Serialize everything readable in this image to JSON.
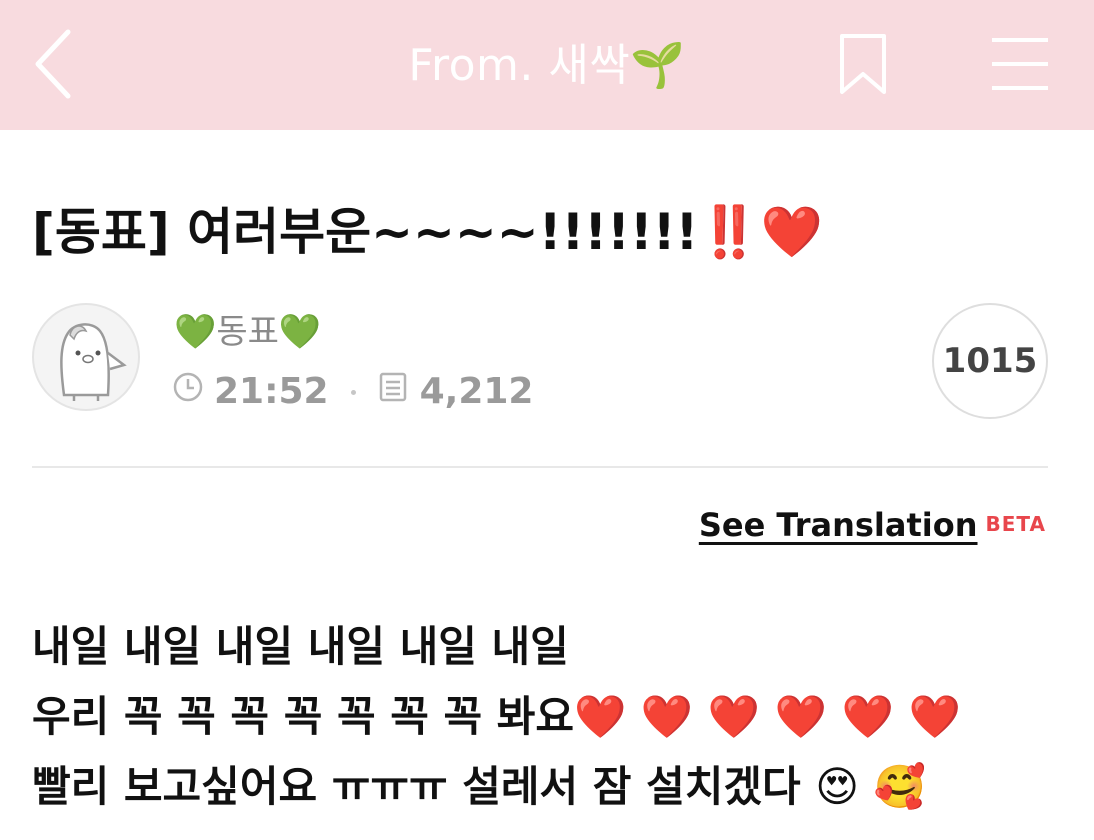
{
  "header": {
    "title": "From. 새싹🌱",
    "background": "#f8dbdf",
    "icons": [
      "back-chevron-icon",
      "bookmark-icon",
      "menu-icon"
    ]
  },
  "post": {
    "title": "[동표] 여러부운~~~~!!!!!!!‼️❤️",
    "author": "💚동표💚",
    "time": "21:52",
    "views": "4,212",
    "comment_count": "1015",
    "translate_label": "See Translation",
    "beta_label": "BETA",
    "body_lines": [
      "내일 내일 내일 내일 내일 내일",
      "우리 꼭 꼭 꼭 꼭 꼭 꼭 꼭 봐요❤️ ❤️ ❤️ ❤️ ❤️ ❤️",
      "빨리 보고싶어요 ㅠㅠㅠ 설레서 잠 설치겠다 😍 🥰"
    ]
  },
  "colors": {
    "accent_beta": "#e8464c",
    "meta_gray": "#9a9a9a"
  }
}
